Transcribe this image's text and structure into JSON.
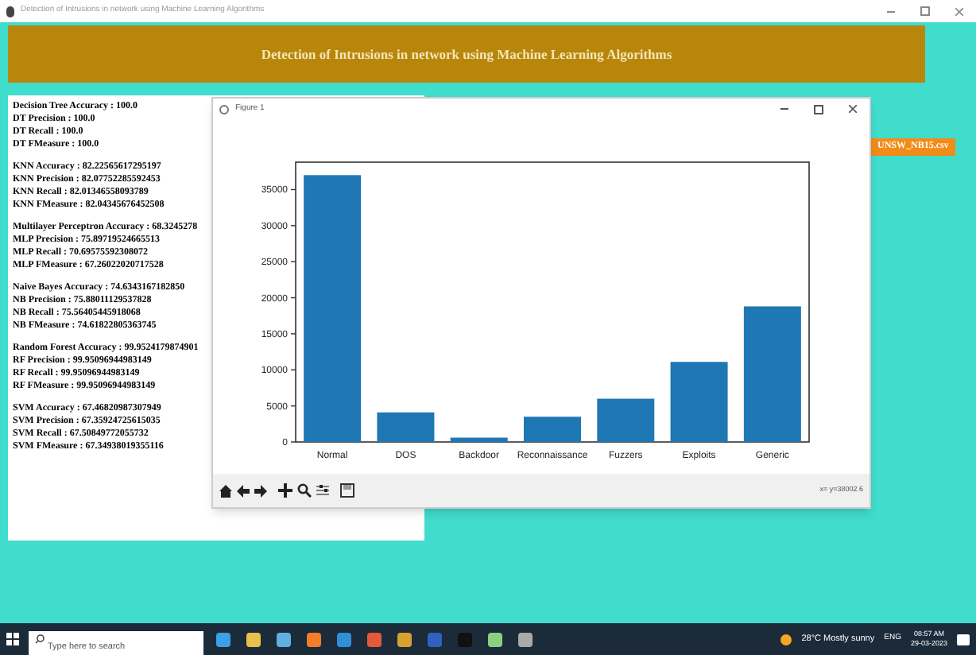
{
  "window": {
    "title": "Detection of Intrusions in network using Machine Learning Algorithms"
  },
  "header": {
    "title": "Detection of Intrusions in network using Machine Learning Algorithms"
  },
  "upload_button": {
    "label": "UNSW_NB15.csv"
  },
  "results": [
    [
      "Decision Tree Accuracy : 100.0",
      "DT Precision : 100.0",
      "DT Recall : 100.0",
      "DT FMeasure : 100.0"
    ],
    [
      "KNN Accuracy : 82.22565617295197",
      "KNN Precision : 82.07752285592453",
      "KNN Recall : 82.01346558093789",
      "KNN FMeasure : 82.04345676452508"
    ],
    [
      "Multilayer Perceptron Accuracy : 68.3245278",
      "MLP Precision : 75.89719524665513",
      "MLP Recall : 70.69575592308072",
      "MLP FMeasure : 67.26022020717528"
    ],
    [
      "Naive Bayes Accuracy : 74.6343167182850",
      "NB Precision : 75.88011129537828",
      "NB Recall : 75.56405445918068",
      "NB FMeasure : 74.61822805363745"
    ],
    [
      "Random Forest Accuracy : 99.9524179874901",
      "RF Precision : 99.95096944983149",
      "RF Recall : 99.95096944983149",
      "RF FMeasure : 99.95096944983149"
    ],
    [
      "SVM Accuracy : 67.46820987307949",
      "SVM Precision : 67.35924725615035",
      "SVM Recall : 67.50849772055732",
      "SVM FMeasure : 67.34938019355116"
    ]
  ],
  "figure": {
    "title": "Figure 1",
    "coords": "x= y=38002.6",
    "chart_data": {
      "type": "bar",
      "categories": [
        "Normal",
        "DOS",
        "Backdoor",
        "Reconnaissance",
        "Fuzzers",
        "Exploits",
        "Generic"
      ],
      "series": [
        {
          "color": "#1f77b4",
          "values": [
            37000,
            4100,
            600,
            3500,
            6000,
            11100,
            18800
          ]
        }
      ],
      "ylim": [
        0,
        38800
      ],
      "yticks": [
        0,
        5000,
        10000,
        15000,
        20000,
        25000,
        30000,
        35000
      ]
    }
  },
  "taskbar": {
    "search_placeholder": "Type here to search",
    "weather": "28°C Mostly sunny",
    "language": "ENG",
    "time": "08:57 AM",
    "date": "29-03-2023"
  }
}
